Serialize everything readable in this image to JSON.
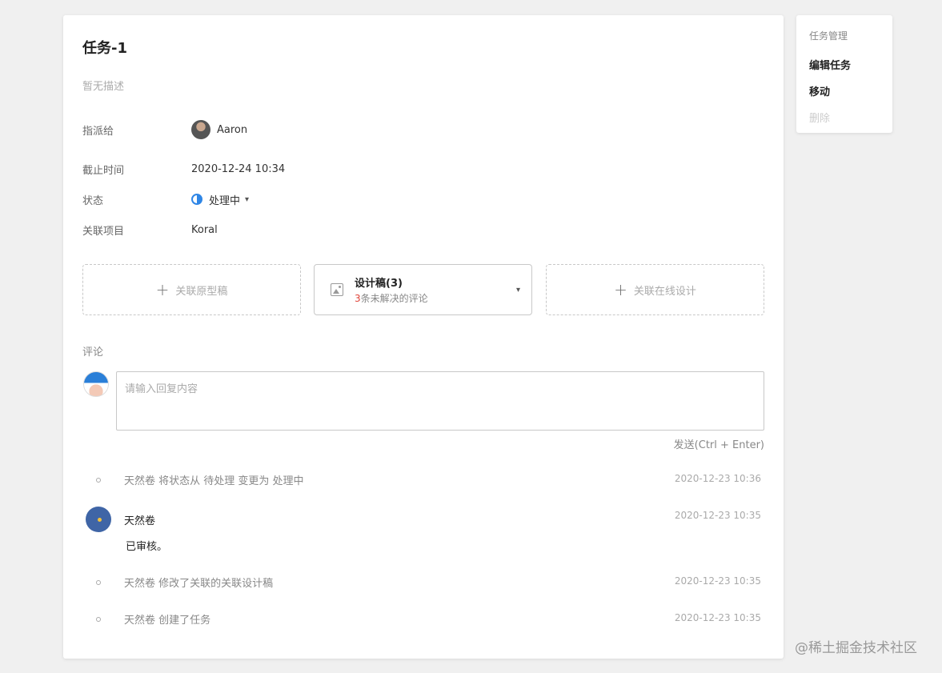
{
  "task": {
    "title": "任务-1",
    "description": "暂无描述",
    "assignee_label": "指派给",
    "assignee": "Aaron",
    "deadline_label": "截止时间",
    "deadline": "2020-12-24 10:34",
    "status_label": "状态",
    "status": "处理中",
    "project_label": "关联项目",
    "project": "Koral"
  },
  "links": {
    "prototype": "关联原型稿",
    "design_title": "设计稿(3)",
    "design_count": "3",
    "design_sub": "条未解决的评论",
    "online": "关联在线设计"
  },
  "comments": {
    "label": "评论",
    "placeholder": "请输入回复内容",
    "send": "发送(Ctrl + Enter)"
  },
  "activities": [
    {
      "text": "天然卷 将状态从 待处理 变更为 处理中",
      "time": "2020-12-23 10:36"
    },
    {
      "author": "天然卷",
      "content": "已审核。",
      "time": "2020-12-23 10:35"
    },
    {
      "text": "天然卷 修改了关联的关联设计稿",
      "time": "2020-12-23 10:35"
    },
    {
      "text": "天然卷 创建了任务",
      "time": "2020-12-23 10:35"
    }
  ],
  "sidebar": {
    "heading": "任务管理",
    "edit": "编辑任务",
    "move": "移动",
    "delete": "删除"
  },
  "watermark": "@稀土掘金技术社区",
  "colors": {
    "link": "#2f79c9",
    "status": "#2f86e6",
    "highlight": "#e0443a"
  }
}
